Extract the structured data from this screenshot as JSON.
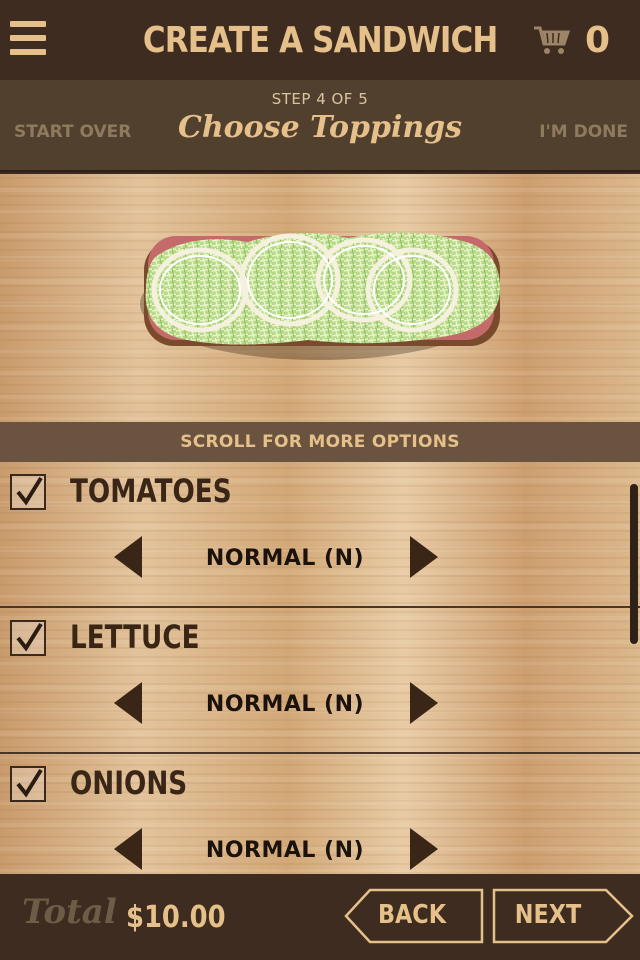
{
  "header": {
    "title": "CREATE A SANDWICH",
    "cart_count": "0",
    "menu_icon": "hamburger-menu-icon",
    "cart_icon": "shopping-cart-icon"
  },
  "step": {
    "label": "STEP 4 OF 5",
    "title": "Choose Toppings",
    "start_over": "START OVER",
    "done": "I'M DONE"
  },
  "scroll_hint": "SCROLL FOR MORE OPTIONS",
  "toppings": [
    {
      "name": "TOMATOES",
      "checked": true,
      "amount": "NORMAL (N)"
    },
    {
      "name": "LETTUCE",
      "checked": true,
      "amount": "NORMAL (N)"
    },
    {
      "name": "ONIONS",
      "checked": true,
      "amount": "NORMAL (N)"
    }
  ],
  "footer": {
    "total_label": "Total",
    "total_value": "$10.00",
    "back_label": "BACK",
    "next_label": "NEXT"
  },
  "colors": {
    "header_bg": "#3d2c1f",
    "accent": "#e6c08a",
    "wood": "#d9b48a"
  }
}
